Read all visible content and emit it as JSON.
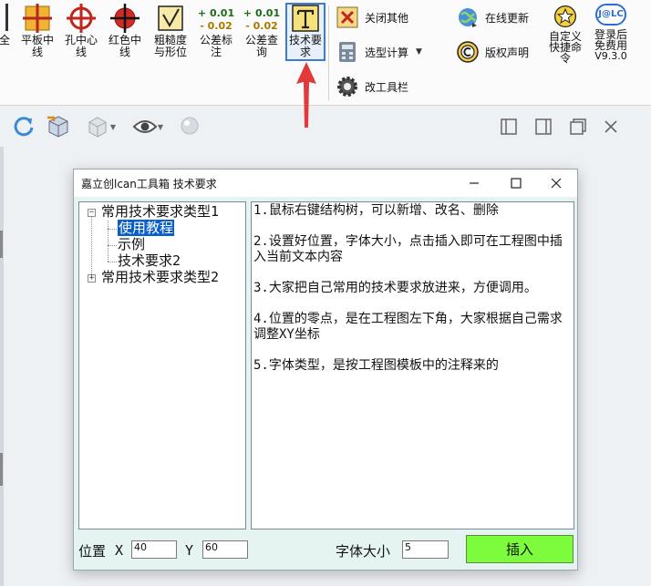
{
  "ribbon": {
    "clipped_label": "全",
    "buttons": [
      {
        "label": "平板中线",
        "line1": "平板中",
        "line2": "线"
      },
      {
        "label": "孔中心线",
        "line1": "孔中心",
        "line2": "线"
      },
      {
        "label": "红色中线",
        "line1": "红色中",
        "line2": "线"
      },
      {
        "label": "粗糙度与形位",
        "line1": "粗糙度",
        "line2": "与形位"
      },
      {
        "label": "公差标注",
        "line1": "公差标",
        "line2": "注",
        "plus": "+ 0.01",
        "minus": "- 0.02"
      },
      {
        "label": "公差查询",
        "line1": "公差查",
        "line2": "询",
        "plus": "+ 0.01",
        "minus": "- 0.02"
      },
      {
        "label": "技术要求",
        "line1": "技术要",
        "line2": "求"
      }
    ],
    "small_buttons": {
      "close_others": "关闭其他",
      "selection_calc": "选型计算",
      "edit_toolbar": "改工具栏",
      "online_update": "在线更新",
      "copyright": "版权声明"
    },
    "custom_cmd": {
      "line1": "自定义",
      "line2": "快捷命",
      "line3": "令"
    },
    "login": {
      "logo": "J@LC",
      "line1": "登录后",
      "line2": "免费用",
      "line3": "V9.3.0"
    }
  },
  "dialog": {
    "title": "嘉立创lcan工具箱 技术要求",
    "tree": [
      {
        "label": "常用技术要求类型1",
        "expanded": true
      },
      {
        "label": "使用教程",
        "selected": true
      },
      {
        "label": "示例"
      },
      {
        "label": "技术要求2"
      },
      {
        "label": "常用技术要求类型2",
        "expanded": false
      }
    ],
    "text_lines": [
      "1.鼠标右键结构树，可以新增、改名、删除",
      "2.设置好位置，字体大小，点击插入即可在工程图中插入当前文本内容",
      "3.大家把自己常用的技术要求放进来，方便调用。",
      "4.位置的零点，是在工程图左下角，大家根据自己需求调整XY坐标",
      "5.字体类型，是按工程图模板中的注释来的"
    ],
    "position_label": "位置",
    "x_label": "X",
    "x_value": "40",
    "y_label": "Y",
    "y_value": "60",
    "font_size_label": "字体大小",
    "font_size_value": "5",
    "insert_label": "插入"
  },
  "colors": {
    "dialog_bg": "#e6f4f1",
    "insert_button": "#7cfc3c",
    "selection": "#0a5fc8",
    "arrow": "#e03a3a"
  }
}
